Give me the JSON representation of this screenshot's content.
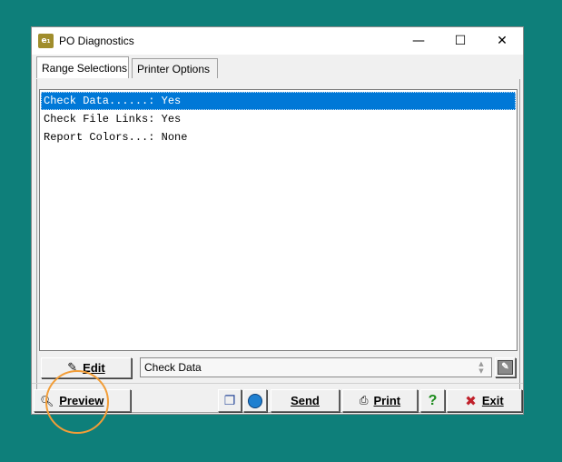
{
  "window": {
    "title": "PO Diagnostics",
    "app_icon_text": "e₁",
    "controls": {
      "minimize": "—",
      "maximize": "☐",
      "close": "✕"
    }
  },
  "tabs": [
    {
      "label": "Range Selections",
      "active": true
    },
    {
      "label": "Printer Options",
      "active": false
    }
  ],
  "list": {
    "items": [
      {
        "text": "Check Data......: Yes",
        "selected": true
      },
      {
        "text": "Check File Links: Yes",
        "selected": false
      },
      {
        "text": "Report Colors...: None",
        "selected": false
      }
    ]
  },
  "edit_bar": {
    "edit_label": "Edit",
    "selected_value": "Check Data"
  },
  "footer": {
    "preview_label": "Preview",
    "send_label": "Send",
    "print_label": "Print",
    "help_label": "?",
    "exit_label": "Exit"
  },
  "colors": {
    "desktop": "#0e7f7a",
    "selection": "#0078d7",
    "highlight_circle": "#f29d37",
    "exit_x": "#c0202a",
    "help": "#1a8a1a"
  }
}
